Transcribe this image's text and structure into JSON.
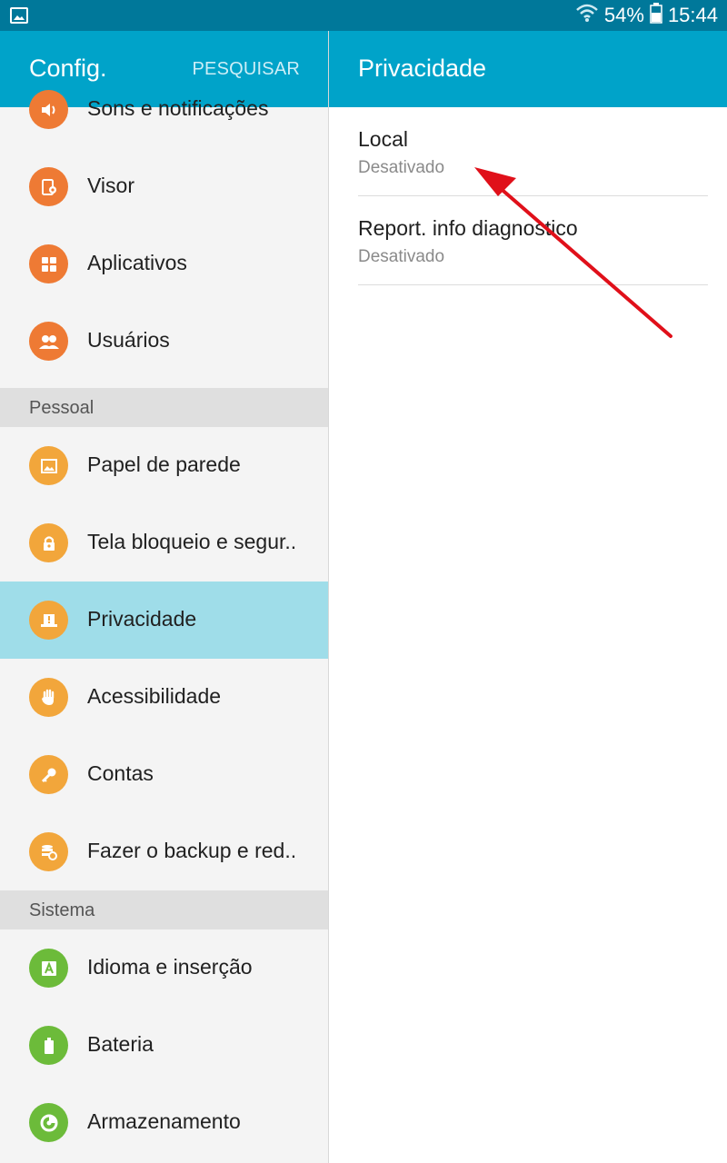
{
  "status_bar": {
    "battery_percent": "54%",
    "time": "15:44",
    "icons": [
      "image-notification-icon",
      "wifi-icon",
      "battery-icon"
    ]
  },
  "left_panel": {
    "title": "Config.",
    "search_label": "PESQUISAR",
    "items_top": [
      {
        "label": "Sons e notificações",
        "icon": "sound-icon"
      },
      {
        "label": "Visor",
        "icon": "display-icon"
      },
      {
        "label": "Aplicativos",
        "icon": "apps-icon"
      },
      {
        "label": "Usuários",
        "icon": "users-icon"
      }
    ],
    "section_personal": "Pessoal",
    "items_personal": [
      {
        "label": "Papel de parede",
        "icon": "wallpaper-icon"
      },
      {
        "label": "Tela bloqueio e segur..",
        "icon": "lock-icon"
      },
      {
        "label": "Privacidade",
        "icon": "privacy-icon",
        "selected": true
      },
      {
        "label": "Acessibilidade",
        "icon": "hand-icon"
      },
      {
        "label": "Contas",
        "icon": "key-icon"
      },
      {
        "label": "Fazer o backup e red..",
        "icon": "backup-icon"
      }
    ],
    "section_system": "Sistema",
    "items_system": [
      {
        "label": "Idioma e inserção",
        "icon": "language-icon"
      },
      {
        "label": "Bateria",
        "icon": "battery-setting-icon"
      },
      {
        "label": "Armazenamento",
        "icon": "storage-icon"
      }
    ]
  },
  "right_panel": {
    "title": "Privacidade",
    "items": [
      {
        "title": "Local",
        "subtitle": "Desativado"
      },
      {
        "title": "Report. info diagnostico",
        "subtitle": "Desativado"
      }
    ]
  },
  "colors": {
    "status_bar": "#00789a",
    "header": "#00a3c9",
    "selected_row": "#9fdde9",
    "orange_icon": "#ee7a34",
    "yellow_icon": "#f2a63b",
    "green_icon": "#6cbb3a",
    "annotation_arrow": "#e0101a"
  }
}
